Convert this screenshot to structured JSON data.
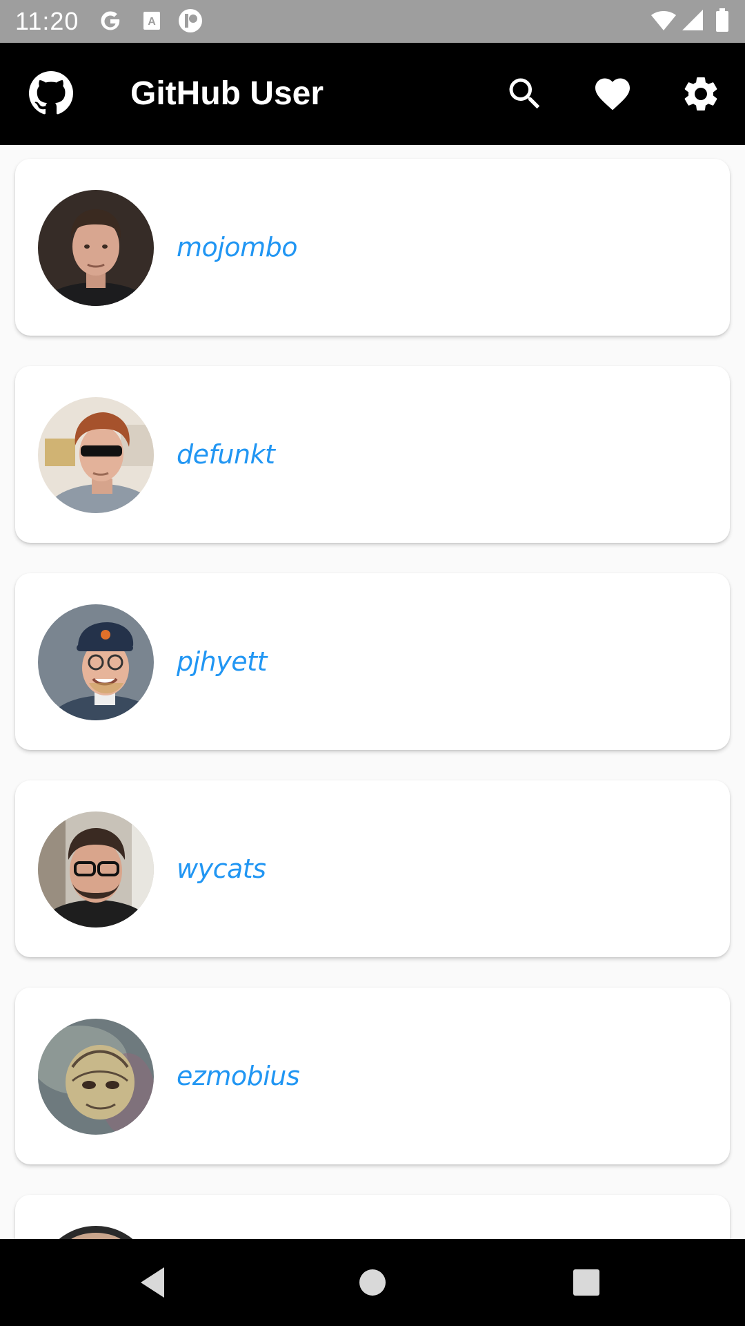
{
  "status_bar": {
    "time": "11:20",
    "icons": [
      "google-icon",
      "text-badge-icon",
      "app-notification-icon",
      "wifi-icon",
      "signal-icon",
      "battery-icon"
    ]
  },
  "app_bar": {
    "title": "GitHub User",
    "logo_icon": "github-logo-icon",
    "actions": [
      "search-icon",
      "heart-icon",
      "settings-gear-icon"
    ]
  },
  "users": [
    {
      "login": "mojombo"
    },
    {
      "login": "defunkt"
    },
    {
      "login": "pjhyett"
    },
    {
      "login": "wycats"
    },
    {
      "login": "ezmobius"
    },
    {
      "login": ""
    }
  ],
  "nav_bar": {
    "icons": [
      "back-triangle-icon",
      "home-circle-icon",
      "recents-square-icon"
    ]
  },
  "colors": {
    "status_bar": "#9e9e9e",
    "app_bar": "#000000",
    "username": "#2196f3",
    "card": "#ffffff",
    "background": "#fafafa"
  }
}
